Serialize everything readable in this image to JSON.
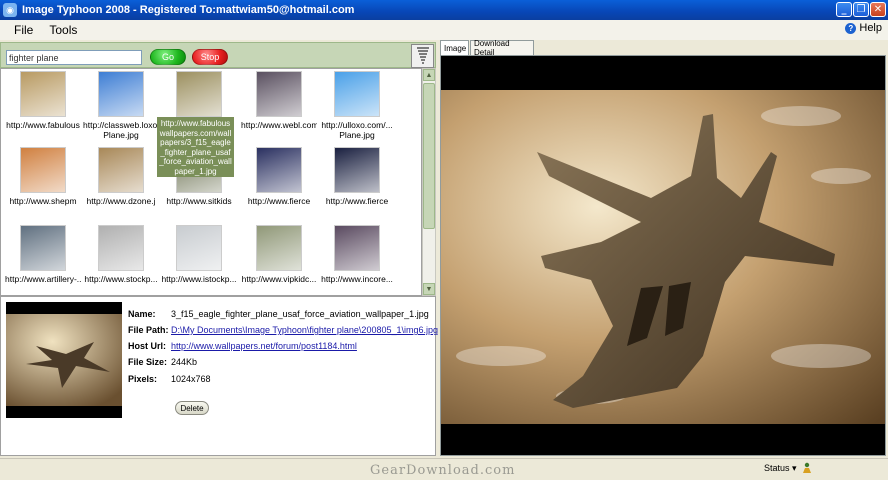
{
  "window": {
    "title": "Image Typhoon 2008 - Registered To:mattwiam50@hotmail.com",
    "minimize": "_",
    "maximize": "❐",
    "close": "✕"
  },
  "menu": {
    "items": [
      {
        "label": "File"
      },
      {
        "label": "Tools"
      }
    ],
    "help": "Help"
  },
  "search": {
    "query": "fighter plane",
    "go": "Go",
    "stop": "Stop"
  },
  "thumbnails": [
    {
      "caption": "http://www.fabulous",
      "bg": "#b89a62"
    },
    {
      "caption": "http://classweb.loxo.",
      "caption2": "Plane.jpg",
      "bg": "#3e7ed4"
    },
    {
      "caption": "",
      "bg": "#9c9060"
    },
    {
      "caption": "http://www.webl.com",
      "bg": "#5a5060"
    },
    {
      "caption": "http://ulloxo.com/...",
      "caption2": "Plane.jpg",
      "bg": "#4aa0e8"
    },
    {
      "caption": "http://www.shepm",
      "bg": "#d08040"
    },
    {
      "caption": "http://www.dzone.j",
      "bg": "#a88858"
    },
    {
      "caption": "http://www.sitkids",
      "bg": "#6a7050"
    },
    {
      "caption": "http://www.fierce",
      "bg": "#2a3060"
    },
    {
      "caption": "http://www.fierce",
      "bg": "#1a2040"
    },
    {
      "caption": "http://www.artillery-...",
      "bg": "#607080"
    },
    {
      "caption": "http://www.stockp...",
      "bg": "#b0b0b0"
    },
    {
      "caption": "http://www.istockp...",
      "bg": "#c8ccd0"
    },
    {
      "caption": "http://www.vipkidc...",
      "bg": "#909878"
    },
    {
      "caption": "http://www.incore...",
      "bg": "#5a4a60"
    }
  ],
  "selected_thumb_label": "http://www.fabulouswallpapers.com/wallpapers/3_f15_eagle_fighter_plane_usaf_force_aviation_wallpaper_1.jpg",
  "details": {
    "name_label": "Name:",
    "name": "3_f15_eagle_fighter_plane_usaf_force_aviation_wallpaper_1.jpg",
    "filepath_label": "File Path:",
    "filepath": "D:\\My Documents\\Image Typhoon\\fighter plane\\200805_1\\img6.jpg",
    "hostname_label": "Host Url:",
    "hosturl": "http://www.wallpapers.net/forum/post1184.html",
    "filesize_label": "File Size:",
    "filesize": "244Kb",
    "pixels_label": "Pixels:",
    "pixels": "1024x768",
    "delete": "Delete"
  },
  "tabs": {
    "image": "Image",
    "download": "Download Detail"
  },
  "status": {
    "watermark": "GearDownload.com",
    "label": "Status ▾"
  }
}
